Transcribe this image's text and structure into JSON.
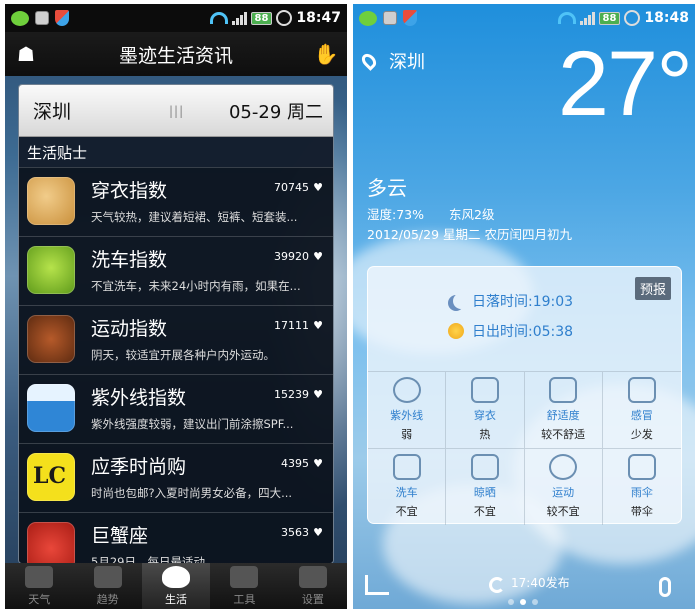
{
  "left": {
    "status": {
      "battery": "88",
      "time": "18:47"
    },
    "title": "墨迹生活资讯",
    "city": "深圳",
    "date": "05-29 周二",
    "section_title": "生活贴士",
    "tips": [
      {
        "icon": "clothing-icon",
        "name": "穿衣指数",
        "count": "70745",
        "desc": "天气较热，建议着短裙、短裤、短套装..."
      },
      {
        "icon": "car-wash-icon",
        "name": "洗车指数",
        "count": "39920",
        "desc": "不宜洗车，未来24小时内有雨，如果在..."
      },
      {
        "icon": "football-icon",
        "name": "运动指数",
        "count": "17111",
        "desc": "阴天，较适宜开展各种户内外运动。"
      },
      {
        "icon": "umbrella-icon",
        "name": "紫外线指数",
        "count": "15239",
        "desc": "紫外线强度较弱，建议出门前涂擦SPF..."
      },
      {
        "icon": "lc-logo-icon",
        "name": "应季时尚购",
        "count": "4395",
        "desc": "时尚也包邮?入夏时尚男女必备，四大..."
      },
      {
        "icon": "crab-icon",
        "name": "巨蟹座",
        "count": "3563",
        "desc": "5月29日，每日最适动..."
      }
    ],
    "tabs": [
      {
        "label": "天气",
        "icon": "weather-icon"
      },
      {
        "label": "趋势",
        "icon": "trend-icon"
      },
      {
        "label": "生活",
        "icon": "life-heart-icon"
      },
      {
        "label": "工具",
        "icon": "toolbox-icon"
      },
      {
        "label": "设置",
        "icon": "settings-gear-icon"
      }
    ]
  },
  "right": {
    "status": {
      "battery": "88",
      "time": "18:48"
    },
    "city": "深圳",
    "temperature": "27°",
    "weather": "多云",
    "humidity": "湿度:73%",
    "wind": "东风2级",
    "date_line": "2012/05/29  星期二  农历闰四月初九",
    "forecast_label": "预报",
    "sunset": "日落时间:19:03",
    "sunrise": "日出时间:05:38",
    "indices": [
      {
        "label": "紫外线",
        "value": "弱",
        "icon": "uv-sun-icon"
      },
      {
        "label": "穿衣",
        "value": "热",
        "icon": "shirt-icon"
      },
      {
        "label": "舒适度",
        "value": "较不舒适",
        "icon": "heart-icon"
      },
      {
        "label": "感冒",
        "value": "少发",
        "icon": "medkit-icon"
      },
      {
        "label": "洗车",
        "value": "不宜",
        "icon": "car-icon"
      },
      {
        "label": "晾晒",
        "value": "不宜",
        "icon": "sock-icon"
      },
      {
        "label": "运动",
        "value": "较不宜",
        "icon": "ball-icon"
      },
      {
        "label": "雨伞",
        "value": "带伞",
        "icon": "umbrella-icon"
      }
    ],
    "published": "17:40发布"
  }
}
